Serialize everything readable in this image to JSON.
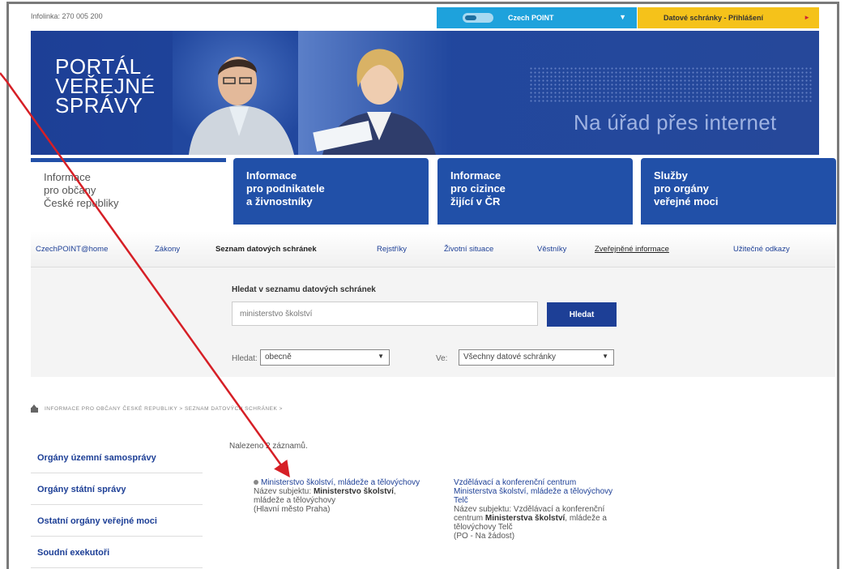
{
  "topbar": {
    "hotline": "Infolinka: 270 005 200",
    "czechpoint_label": "Czech POINT",
    "czechpoint_arrow": "▼",
    "datovky_label": "Datové schránky - Přihlášení",
    "datovky_arrow": "►"
  },
  "banner": {
    "line1": "PORTÁL",
    "line2": "VEŘEJNÉ",
    "line3": "SPRÁVY",
    "slogan": "Na úřad přes internet"
  },
  "tabs": [
    {
      "line1": "Informace",
      "line2": "pro občany",
      "line3": "České republiky"
    },
    {
      "line1": "Informace",
      "line2": "pro podnikatele",
      "line3": "a živnostníky"
    },
    {
      "line1": "Informace",
      "line2": "pro cizince",
      "line3": "žijící v ČR"
    },
    {
      "line1": "Služby",
      "line2": "pro orgány",
      "line3": "veřejné moci"
    }
  ],
  "nav": [
    "CzechPOINT@home",
    "Zákony",
    "Seznam datových schránek",
    "Rejstříky",
    "Životní situace",
    "Věstníky",
    "Zveřejněné informace",
    "Užitečné odkazy"
  ],
  "search": {
    "title": "Hledat v seznamu datových schránek",
    "value": "ministerstvo školství",
    "button": "Hledat",
    "filter1_label": "Hledat:",
    "filter1_value": "obecně",
    "filter2_label": "Ve:",
    "filter2_value": "Všechny datové schránky"
  },
  "breadcrumb": "INFORMACE PRO OBČANY ČESKÉ REPUBLIKY  >  SEZNAM DATOVÝCH SCHRÁNEK  >",
  "sidebar": [
    "Orgány územní samosprávy",
    "Orgány státní správy",
    "Ostatní orgány veřejné moci",
    "Soudní exekutoři"
  ],
  "results": {
    "found": "Nalezeno 2 záznamů.",
    "r1_title": "Ministerstvo školství, mládeže a tělovýchovy",
    "r1_prefix": "Název subjektu: ",
    "r1_bold": "Ministerstvo školství",
    "r1_rest": ", mládeže a tělovýchovy",
    "r1_place": "(Hlavní město Praha)",
    "r2_title": "Vzdělávací a konferenční centrum Ministerstva školství, mládeže a tělovýchovy Telč",
    "r2_prefix": "Název subjektu: Vzdělávací a konferenční centrum ",
    "r2_bold": "Ministerstva školství",
    "r2_rest": ", mládeže a tělovýchovy Telč",
    "r2_place": "(PO - Na žádost)"
  },
  "colors": {
    "brand_blue": "#1d3f96",
    "czechpoint_blue": "#1ea2dc",
    "datovky_yellow": "#f5c21a",
    "annotation_red": "#d61f26"
  }
}
